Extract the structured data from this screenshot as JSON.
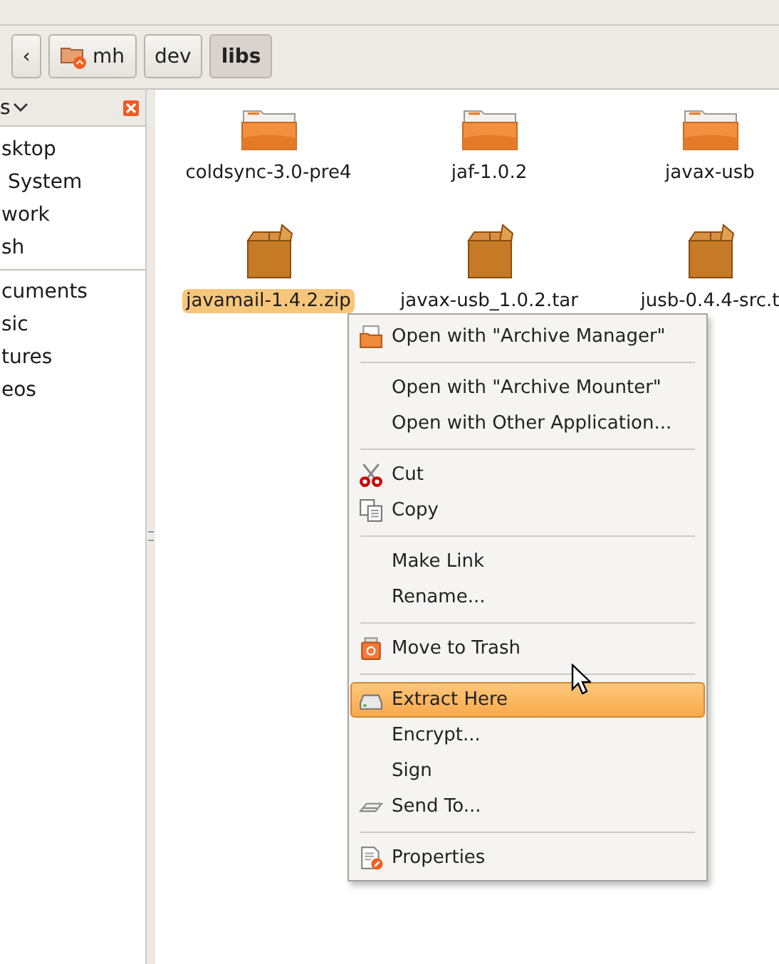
{
  "toolbar": {
    "back_button": "‹",
    "path": [
      {
        "label": "mh",
        "kind": "home",
        "selected": false
      },
      {
        "label": "dev",
        "kind": "plain",
        "selected": false
      },
      {
        "label": "libs",
        "kind": "plain",
        "selected": true
      }
    ]
  },
  "sidebar": {
    "header": "s",
    "items": [
      {
        "label": "sktop"
      },
      {
        "label": " System"
      },
      {
        "label": "work"
      },
      {
        "label": "sh"
      },
      {
        "kind": "separator"
      },
      {
        "label": "cuments"
      },
      {
        "label": "sic"
      },
      {
        "label": "tures"
      },
      {
        "label": "eos"
      }
    ]
  },
  "files": [
    {
      "name": "coldsync-3.0-pre4",
      "kind": "folder",
      "selected": false
    },
    {
      "name": "jaf-1.0.2",
      "kind": "folder",
      "selected": false
    },
    {
      "name": "javax-usb",
      "kind": "folder",
      "selected": false
    },
    {
      "name": "javamail-1.4.2.zip",
      "kind": "package",
      "selected": true
    },
    {
      "name": "javax-usb_1.0.2.tar",
      "kind": "package",
      "selected": false
    },
    {
      "name": "jusb-0.4.4-src.t",
      "kind": "package",
      "selected": false
    }
  ],
  "context_menu": {
    "items": [
      {
        "kind": "item",
        "label": "Open with \"Archive Manager\"",
        "selected": false
      },
      {
        "kind": "separator"
      },
      {
        "kind": "item",
        "label": "Open with \"Archive Mounter\"",
        "selected": false
      },
      {
        "kind": "item",
        "label": "Open with Other Application...",
        "selected": false
      },
      {
        "kind": "separator"
      },
      {
        "kind": "item",
        "label": "Cut",
        "selected": false
      },
      {
        "kind": "item",
        "label": "Copy",
        "selected": false
      },
      {
        "kind": "separator"
      },
      {
        "kind": "item",
        "label": "Make Link",
        "selected": false
      },
      {
        "kind": "item",
        "label": "Rename...",
        "selected": false
      },
      {
        "kind": "separator"
      },
      {
        "kind": "item",
        "label": "Move to Trash",
        "selected": false
      },
      {
        "kind": "separator"
      },
      {
        "kind": "item",
        "label": "Extract Here",
        "selected": true
      },
      {
        "kind": "item",
        "label": "Encrypt...",
        "selected": false
      },
      {
        "kind": "item",
        "label": "Sign",
        "selected": false
      },
      {
        "kind": "item",
        "label": "Send To...",
        "selected": false
      },
      {
        "kind": "separator"
      },
      {
        "kind": "item",
        "label": "Properties",
        "selected": false
      }
    ]
  }
}
